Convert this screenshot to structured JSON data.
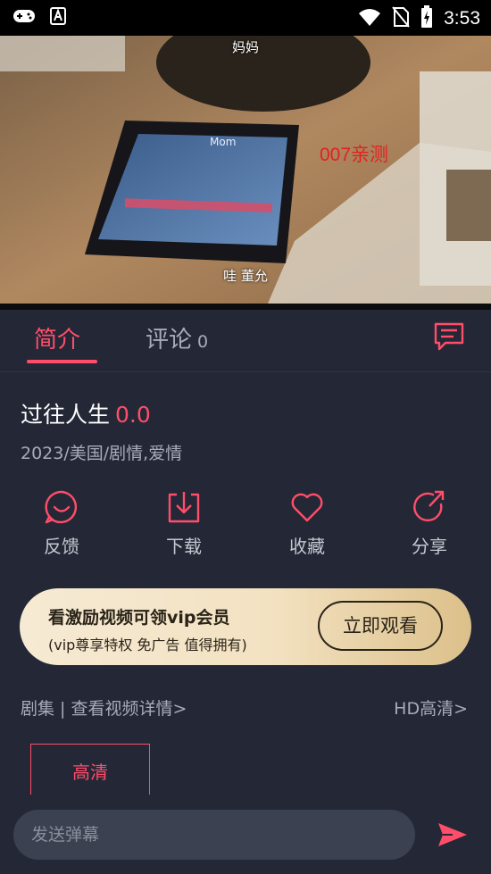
{
  "status_bar": {
    "time": "3:53",
    "left_icons": [
      "gamepad-icon",
      "font-a-icon"
    ],
    "right_icons": [
      "wifi-icon",
      "no-sim-icon",
      "battery-charging-icon"
    ]
  },
  "video": {
    "subtitle_top": "妈妈",
    "subtitle_bottom": "哇 董允",
    "watermark": "007亲测"
  },
  "tabs": {
    "intro_label": "简介",
    "comments_label": "评论",
    "comments_count": "0",
    "danmaku_icon": "danmaku-list-icon"
  },
  "movie": {
    "title": "过往人生",
    "score": "0.0",
    "meta": "2023/美国/剧情,爱情"
  },
  "actions": [
    {
      "label": "反馈",
      "icon": "feedback-icon"
    },
    {
      "label": "下载",
      "icon": "download-icon"
    },
    {
      "label": "收藏",
      "icon": "heart-icon"
    },
    {
      "label": "分享",
      "icon": "share-icon"
    }
  ],
  "vip": {
    "title": "看激励视频可领vip会员",
    "subtitle": "(vip尊享特权 免广告 值得拥有)",
    "button": "立即观看"
  },
  "episodes": {
    "label": "剧集 | 查看视频详情>",
    "quality_link": "HD高清>",
    "chips": [
      "高清"
    ]
  },
  "bottom_bar": {
    "input_placeholder": "发送弹幕",
    "send_icon": "send-icon"
  },
  "colors": {
    "accent": "#ff4d6a",
    "background": "#242836",
    "vip_gold": "#dcc08a"
  }
}
